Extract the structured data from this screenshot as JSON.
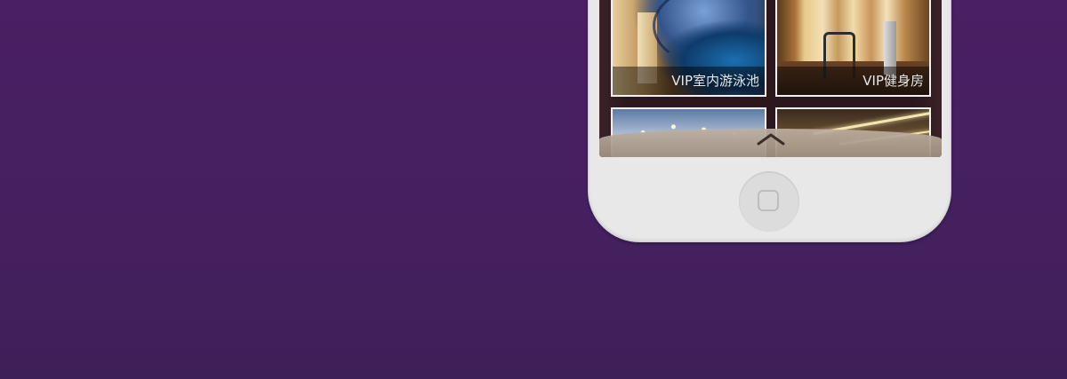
{
  "page": {
    "background_color": "#44205f"
  },
  "phone": {
    "color": "#e8e8e8",
    "screen": {
      "tiles": [
        {
          "label": "VIP室内游泳池"
        },
        {
          "label": "VIP健身房"
        },
        {
          "label": ""
        },
        {
          "label": ""
        }
      ],
      "pull_icon": "chevron-up-icon"
    },
    "home_button_icon": "home-button-square-icon"
  }
}
